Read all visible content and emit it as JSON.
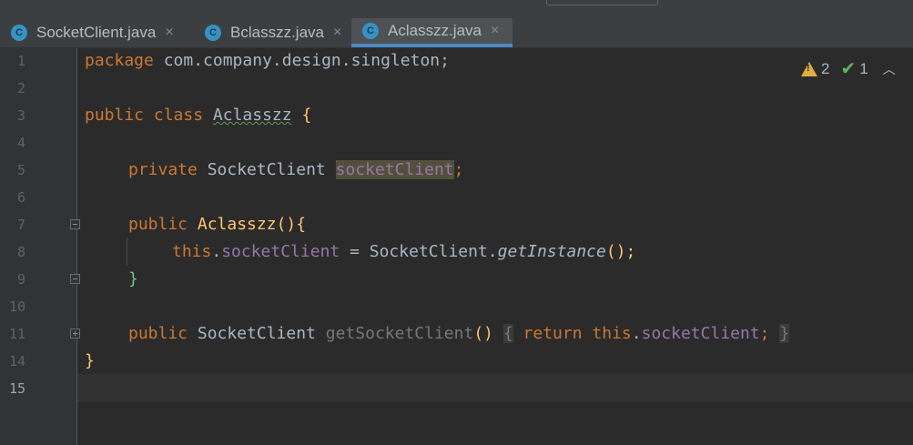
{
  "tabs": [
    {
      "label": "SocketClient.java",
      "icon": "java-class-icon",
      "icon_letter": "C",
      "active": false
    },
    {
      "label": "Bclasszz.java",
      "icon": "java-class-icon",
      "icon_letter": "C",
      "active": false
    },
    {
      "label": "Aclasszz.java",
      "icon": "java-class-icon",
      "icon_letter": "C",
      "active": true
    }
  ],
  "close_glyph": "×",
  "gutter": {
    "line_numbers": [
      "1",
      "2",
      "3",
      "4",
      "5",
      "6",
      "7",
      "8",
      "9",
      "10",
      "11",
      "14",
      "15"
    ],
    "current_line": "15"
  },
  "inspections": {
    "warnings": "2",
    "typos": "1"
  },
  "code": {
    "l1": {
      "kw": "package",
      "rest": " com.company.design.singleton;"
    },
    "l3": {
      "kw": "public class",
      "name": "Aclasszz",
      "brace": "{"
    },
    "l5": {
      "kw": "private",
      "type": "SocketClient",
      "field": "socketClient",
      "semi": ";"
    },
    "l7": {
      "kw": "public",
      "name": "Aclasszz",
      "parens": "(){"
    },
    "l8": {
      "this": "this",
      "dot": ".",
      "field": "socketClient",
      "eq": " = SocketClient.",
      "method": "getInstance",
      "tail": "();"
    },
    "l9": {
      "brace": "}"
    },
    "l11": {
      "kw": "public",
      "type": "SocketClient",
      "method": "getSocketClient",
      "parens": "()",
      "ob": "{",
      "ret": "return",
      "this": "this",
      "dot": ".",
      "field": "socketClient",
      "semi": ";",
      "cb": "}"
    },
    "l14": {
      "brace": "}"
    }
  },
  "colors": {
    "keyword": "#cc7832",
    "function": "#ffc66d",
    "field": "#9876aa",
    "text": "#a9b7c6",
    "tab_active_underline": "#4a88c7",
    "warning": "#e0ae3b"
  }
}
